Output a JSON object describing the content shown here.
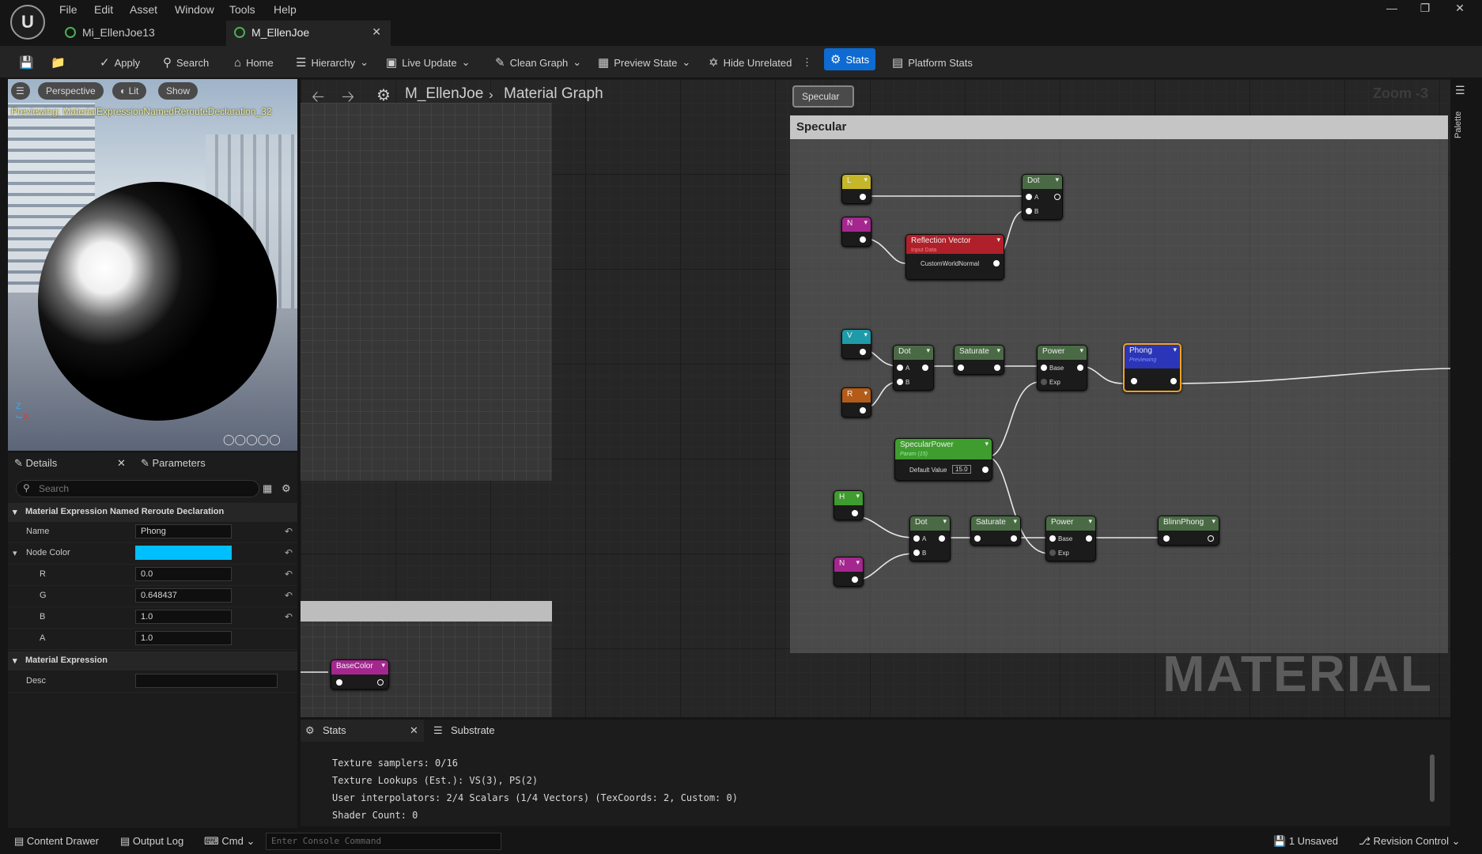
{
  "menu": [
    "File",
    "Edit",
    "Asset",
    "Window",
    "Tools",
    "Help"
  ],
  "tabs": [
    {
      "label": "Mi_EllenJoe13"
    },
    {
      "label": "M_EllenJoe"
    }
  ],
  "toolbar": {
    "apply": "Apply",
    "search": "Search",
    "home": "Home",
    "hierarchy": "Hierarchy",
    "live_update": "Live Update",
    "clean_graph": "Clean Graph",
    "preview_state": "Preview State",
    "hide_unrelated": "Hide Unrelated",
    "stats": "Stats",
    "platform_stats": "Platform Stats"
  },
  "viewport": {
    "perspective": "Perspective",
    "lit": "Lit",
    "show": "Show",
    "previewing": "Previewing: MaterialExpressionNamedRerouteDeclaration_32"
  },
  "details": {
    "tab_details": "Details",
    "tab_parameters": "Parameters",
    "search_placeholder": "Search",
    "section1": "Material Expression Named Reroute Declaration",
    "name_label": "Name",
    "name_value": "Phong",
    "node_color_label": "Node Color",
    "node_color_value": "#00bfff",
    "r_label": "R",
    "r_value": "0.0",
    "g_label": "G",
    "g_value": "0.648437",
    "b_label": "B",
    "b_value": "1.0",
    "a_label": "A",
    "a_value": "1.0",
    "section2": "Material Expression",
    "desc_label": "Desc",
    "desc_value": ""
  },
  "graph": {
    "asset": "M_EllenJoe",
    "graph_name": "Material Graph",
    "zoom": "Zoom -3",
    "watermark": "MATERIAL",
    "palette": "Palette",
    "comment_title": "Specular",
    "comment_button": "Specular",
    "nodes": {
      "l": "L",
      "n1": "N",
      "v": "V",
      "r": "R",
      "h": "H",
      "n2": "N",
      "dot1": "Dot",
      "dot2": "Dot",
      "dot3": "Dot",
      "reflection": "Reflection Vector",
      "reflection_sub": "Input Data",
      "reflection_pin": "CustomWorldNormal",
      "saturate1": "Saturate",
      "saturate2": "Saturate",
      "power1": "Power",
      "power2": "Power",
      "phong": "Phong",
      "phong_sub": "Previewing",
      "specpower": "SpecularPower",
      "specpower_sub": "Param (15)",
      "specpower_default_label": "Default Value",
      "specpower_default": "15.0",
      "blinnphong": "BlinnPhong",
      "basecolor": "BaseColor",
      "pin_a": "A",
      "pin_b": "B",
      "pin_base": "Base",
      "pin_exp": "Exp"
    },
    "colors": {
      "yellow": "#c5b62a",
      "magenta": "#a4278f",
      "cyan": "#1f9aa8",
      "orange": "#b35c19",
      "green": "#3f9c2f",
      "darkgreen": "#4a6a45",
      "red": "#b0202a",
      "blue": "#2a35b7",
      "selected": "#f3a21c"
    }
  },
  "stats_panel": {
    "tab_stats": "Stats",
    "tab_substrate": "Substrate",
    "lines": [
      "Texture samplers: 0/16",
      "Texture Lookups (Est.): VS(3), PS(2)",
      "User interpolators: 2/4 Scalars (1/4 Vectors) (TexCoords: 2, Custom: 0)",
      "Shader Count: 0"
    ]
  },
  "statusbar": {
    "content_drawer": "Content Drawer",
    "output_log": "Output Log",
    "cmd": "Cmd",
    "console_placeholder": "Enter Console Command",
    "unsaved": "1 Unsaved",
    "revision": "Revision Control"
  }
}
